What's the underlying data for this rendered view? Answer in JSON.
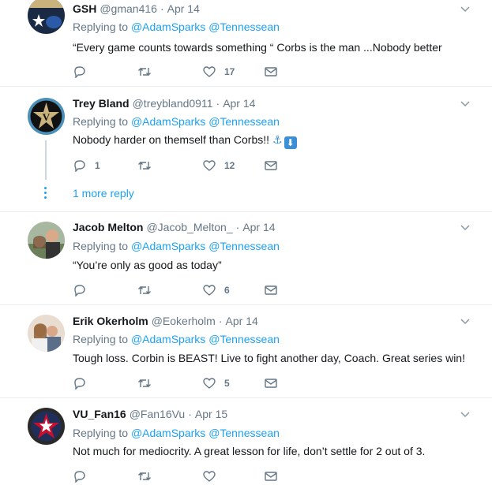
{
  "colors": {
    "link": "#1da1f2",
    "muted": "#657786",
    "divider": "#e6ecf0"
  },
  "tweets": [
    {
      "name": "GSH",
      "handle": "@gman416",
      "sep": "·",
      "date": "Apr 14",
      "replying_prefix": "Replying to",
      "mention1": "@AdamSparks",
      "mention2": "@Tennessean",
      "text": "“Every game counts towards something “ Corbs is the man ...Nobody better",
      "reply_count": "",
      "retweet_count": "",
      "like_count": "17"
    },
    {
      "name": "Trey Bland",
      "handle": "@treybland0911",
      "sep": "·",
      "date": "Apr 14",
      "replying_prefix": "Replying to",
      "mention1": "@AdamSparks",
      "mention2": "@Tennessean",
      "text": "Nobody harder on themself than Corbs!!",
      "emoji1": "⚓",
      "emoji2": "⬇",
      "reply_count": "1",
      "retweet_count": "",
      "like_count": "12",
      "more_replies": "1 more reply"
    },
    {
      "name": "Jacob Melton",
      "handle": "@Jacob_Melton_",
      "sep": "·",
      "date": "Apr 14",
      "replying_prefix": "Replying to",
      "mention1": "@AdamSparks",
      "mention2": "@Tennessean",
      "text": "“You’re only as good as today”",
      "reply_count": "",
      "retweet_count": "",
      "like_count": "6"
    },
    {
      "name": "Erik Okerholm",
      "handle": "@Eokerholm",
      "sep": "·",
      "date": "Apr 14",
      "replying_prefix": "Replying to",
      "mention1": "@AdamSparks",
      "mention2": "@Tennessean",
      "text": "Tough loss. Corbin is BEAST! Live to fight another day, Coach. Great series win!",
      "reply_count": "",
      "retweet_count": "",
      "like_count": "5"
    },
    {
      "name": "VU_Fan16",
      "handle": "@Fan16Vu",
      "sep": "·",
      "date": "Apr 15",
      "replying_prefix": "Replying to",
      "mention1": "@AdamSparks",
      "mention2": "@Tennessean",
      "text": "Not much for mediocrity. A great lesson for life, don’t settle for 2 out of 3.",
      "reply_count": "",
      "retweet_count": "",
      "like_count": ""
    }
  ]
}
